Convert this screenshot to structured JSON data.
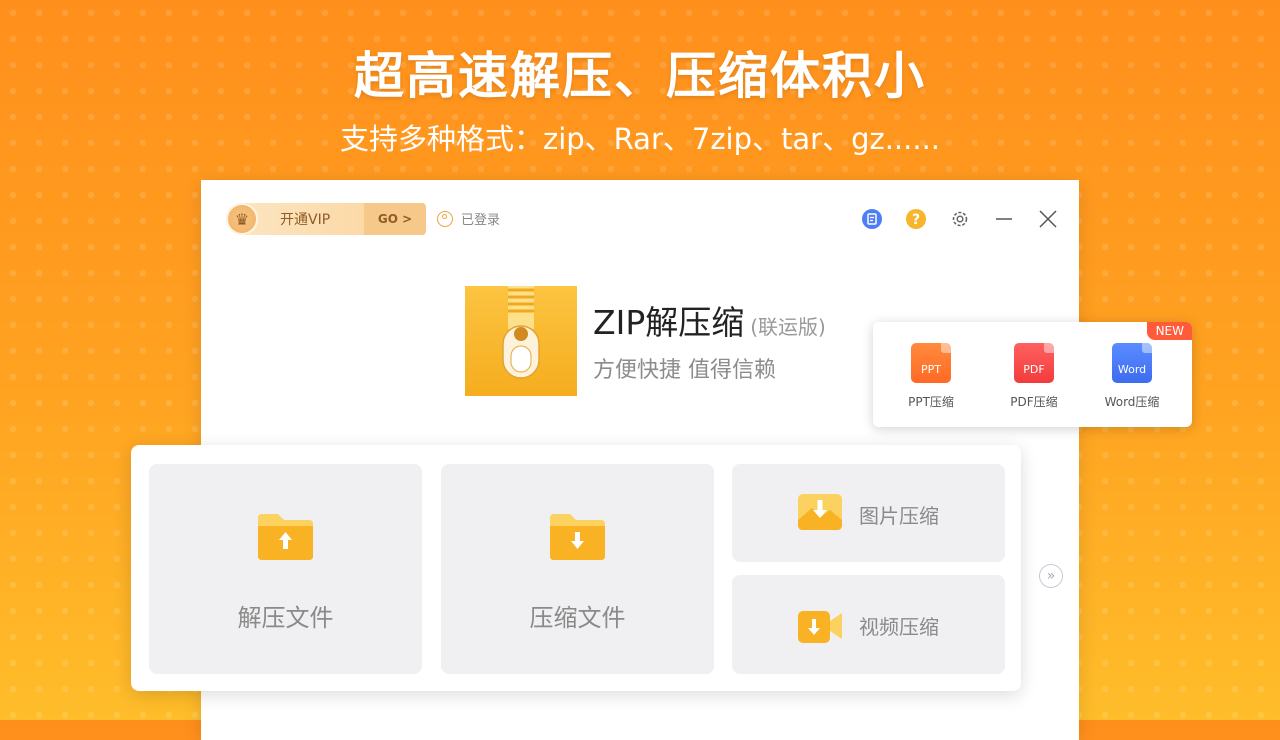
{
  "banner": {
    "headline": "超高速解压、压缩体积小",
    "subline": "支持多种格式：zip、Rar、7zip、tar、gz......"
  },
  "titlebar": {
    "vip_label": "开通VIP",
    "vip_go": "GO >",
    "login_status": "已登录"
  },
  "app": {
    "title": "ZIP解压缩",
    "edition": "(联运版)",
    "slogan": "方便快捷 值得信赖"
  },
  "tools_popup": {
    "badge": "NEW",
    "items": [
      {
        "icon_text": "PPT",
        "label": "PPT压缩",
        "color": "#ff7a2e"
      },
      {
        "icon_text": "PDF",
        "label": "PDF压缩",
        "color": "#ff4d4d"
      },
      {
        "icon_text": "Word",
        "label": "Word压缩",
        "color": "#4d7ef5"
      }
    ]
  },
  "actions": {
    "extract": "解压文件",
    "compress": "压缩文件",
    "image_compress": "图片压缩",
    "video_compress": "视频压缩"
  },
  "colors": {
    "accent": "#f8b223",
    "background_top": "#ff8f1c",
    "background_bottom": "#ffbd2a",
    "new_badge": "#ff5b3a"
  }
}
